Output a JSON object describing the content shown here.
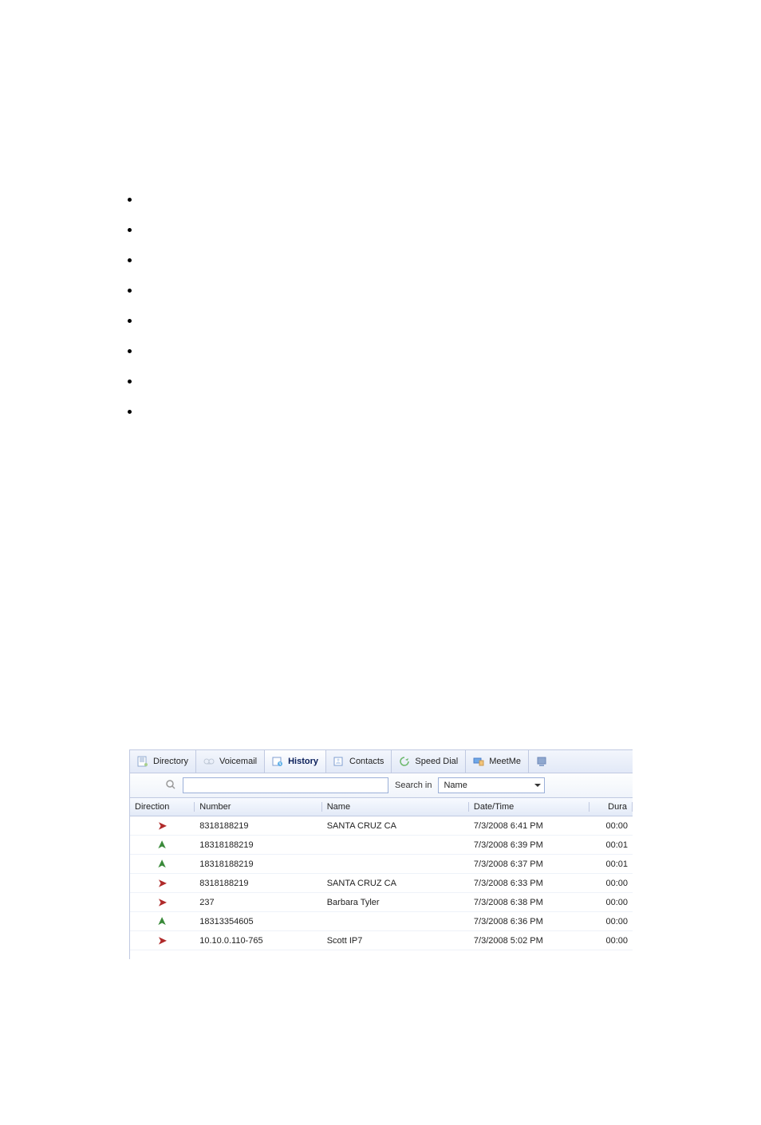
{
  "bullets": {
    "groupA": 3,
    "groupB": 3,
    "groupC": 2
  },
  "tabs": [
    {
      "id": "directory",
      "label": "Directory"
    },
    {
      "id": "voicemail",
      "label": "Voicemail"
    },
    {
      "id": "history",
      "label": "History",
      "active": true
    },
    {
      "id": "contacts",
      "label": "Contacts"
    },
    {
      "id": "speeddial",
      "label": "Speed Dial"
    },
    {
      "id": "meetme",
      "label": "MeetMe"
    },
    {
      "id": "extra",
      "label": ""
    }
  ],
  "search": {
    "label": "Search in",
    "value": "",
    "select_value": "Name"
  },
  "columns": {
    "direction": "Direction",
    "number": "Number",
    "name": "Name",
    "datetime": "Date/Time",
    "duration": "Dura"
  },
  "rows": [
    {
      "direction": "out",
      "number": "8318188219",
      "name": "SANTA CRUZ  CA",
      "datetime": "7/3/2008 6:41 PM",
      "duration": "00:00"
    },
    {
      "direction": "in",
      "number": "18318188219",
      "name": "",
      "datetime": "7/3/2008 6:39 PM",
      "duration": "00:01"
    },
    {
      "direction": "in",
      "number": "18318188219",
      "name": "",
      "datetime": "7/3/2008 6:37 PM",
      "duration": "00:01"
    },
    {
      "direction": "out",
      "number": "8318188219",
      "name": "SANTA CRUZ  CA",
      "datetime": "7/3/2008 6:33 PM",
      "duration": "00:00"
    },
    {
      "direction": "out",
      "number": "237",
      "name": "Barbara Tyler",
      "datetime": "7/3/2008 6:38 PM",
      "duration": "00:00"
    },
    {
      "direction": "in",
      "number": "18313354605",
      "name": "",
      "datetime": "7/3/2008 6:36 PM",
      "duration": "00:00"
    },
    {
      "direction": "out",
      "number": "10.10.0.110-765",
      "name": "Scott IP7",
      "datetime": "7/3/2008 5:02 PM",
      "duration": "00:00"
    }
  ]
}
